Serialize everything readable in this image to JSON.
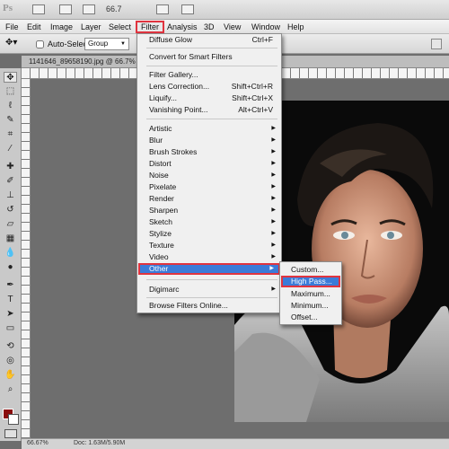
{
  "app": {
    "logo": "Ps",
    "zoom": "66.7"
  },
  "menubar": {
    "items": [
      "File",
      "Edit",
      "Image",
      "Layer",
      "Select",
      "Filter",
      "Analysis",
      "3D",
      "View",
      "Window",
      "Help"
    ],
    "active": "Filter"
  },
  "options": {
    "auto_select_label": "Auto-Select:",
    "group_value": "Group"
  },
  "document": {
    "tab_label": "1141646_89658190.jpg @ 66.7% (RGB/8)"
  },
  "status": {
    "zoom": "66.67%",
    "doc": "Doc: 1.63M/5.90M"
  },
  "filter_menu": {
    "items": [
      {
        "label": "Diffuse Glow",
        "shortcut": "Ctrl+F"
      },
      {
        "label": "Convert for Smart Filters"
      },
      {
        "label": "Filter Gallery..."
      },
      {
        "label": "Lens Correction...",
        "shortcut": "Shift+Ctrl+R"
      },
      {
        "label": "Liquify...",
        "shortcut": "Shift+Ctrl+X"
      },
      {
        "label": "Vanishing Point...",
        "shortcut": "Alt+Ctrl+V"
      },
      {
        "label": "Artistic",
        "submenu": true
      },
      {
        "label": "Blur",
        "submenu": true
      },
      {
        "label": "Brush Strokes",
        "submenu": true
      },
      {
        "label": "Distort",
        "submenu": true
      },
      {
        "label": "Noise",
        "submenu": true
      },
      {
        "label": "Pixelate",
        "submenu": true
      },
      {
        "label": "Render",
        "submenu": true
      },
      {
        "label": "Sharpen",
        "submenu": true
      },
      {
        "label": "Sketch",
        "submenu": true
      },
      {
        "label": "Stylize",
        "submenu": true
      },
      {
        "label": "Texture",
        "submenu": true
      },
      {
        "label": "Video",
        "submenu": true
      },
      {
        "label": "Other",
        "submenu": true
      },
      {
        "label": "Digimarc",
        "submenu": true
      },
      {
        "label": "Browse Filters Online..."
      }
    ]
  },
  "other_submenu": {
    "items": [
      "Custom...",
      "High Pass...",
      "Maximum...",
      "Minimum...",
      "Offset..."
    ],
    "highlighted": "High Pass..."
  },
  "colors": {
    "highlight": "#3b7bd8",
    "callout": "#e0343f",
    "foreground": "#8a0d0d",
    "background": "#ffffff"
  }
}
